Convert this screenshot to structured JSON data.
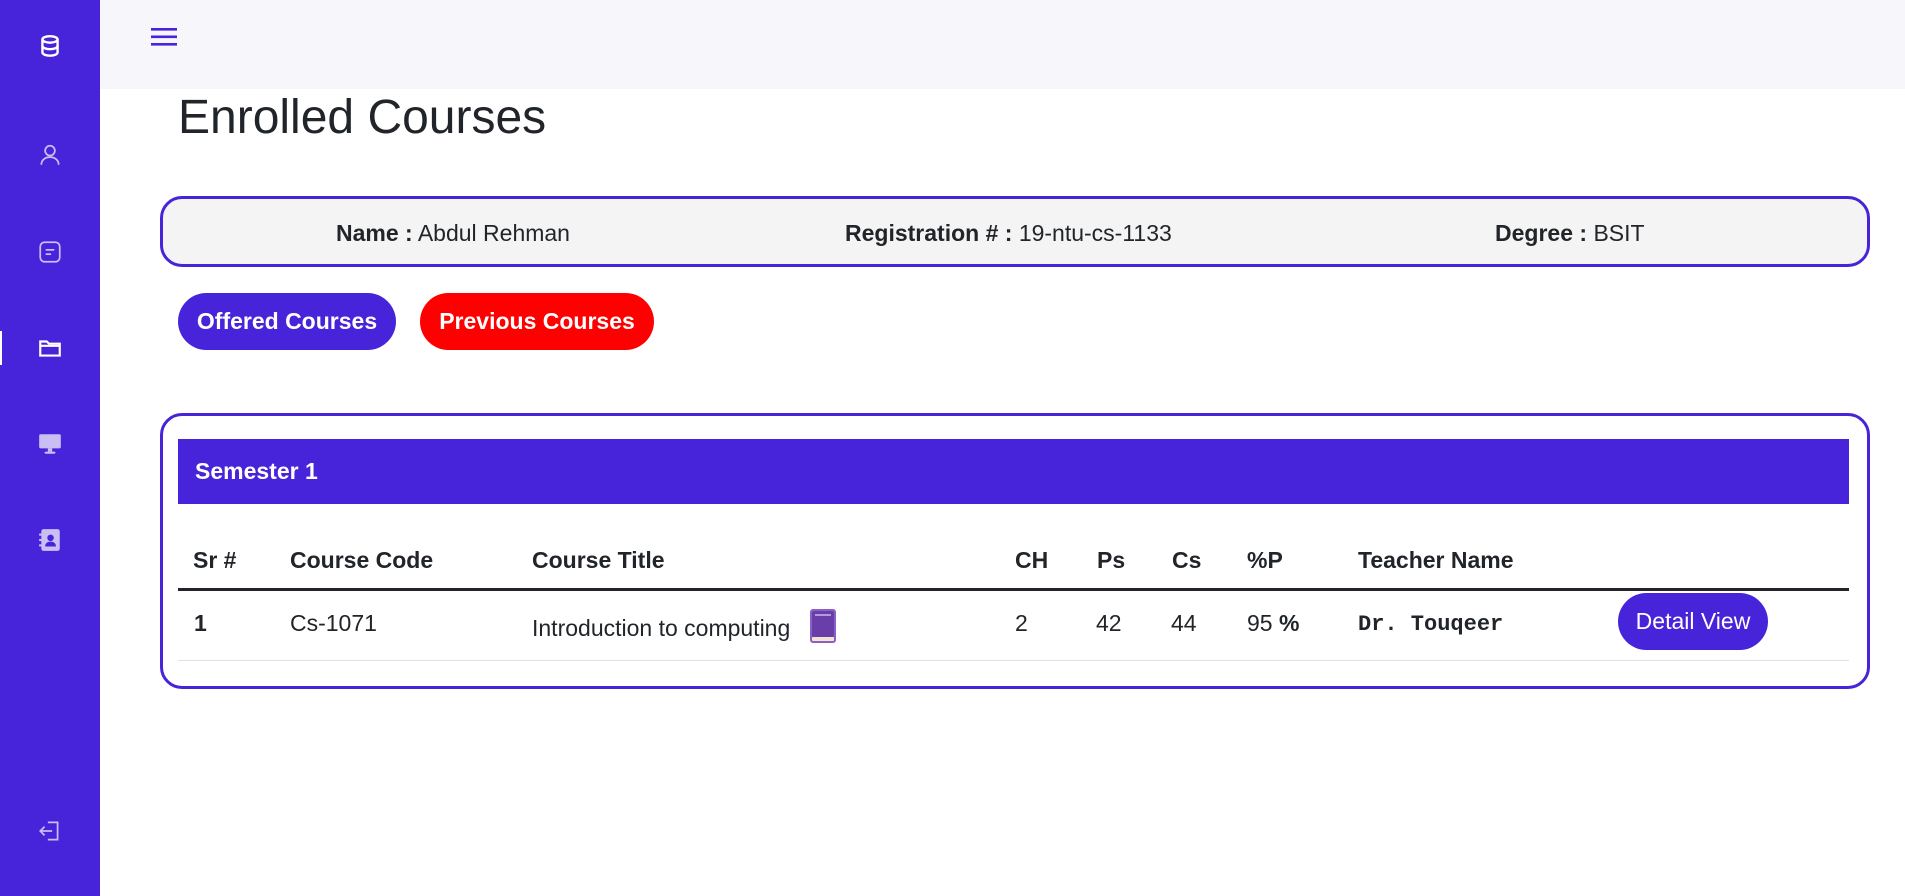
{
  "sidebar": {
    "items": [
      {
        "icon": "database-icon"
      },
      {
        "icon": "user-icon"
      },
      {
        "icon": "message-icon"
      },
      {
        "icon": "folder-icon",
        "active": true
      },
      {
        "icon": "monitor-icon"
      },
      {
        "icon": "contact-card-icon"
      },
      {
        "icon": "logout-icon"
      }
    ],
    "color": "#4723d9"
  },
  "header": {
    "menu_icon": "hamburger-icon"
  },
  "page": {
    "title": "Enrolled Courses"
  },
  "student": {
    "name_label": "Name :",
    "name_value": "Abdul Rehman",
    "reg_label": "Registration # :",
    "reg_value": "19-ntu-cs-1133",
    "degree_label": "Degree :",
    "degree_value": "BSIT"
  },
  "actions": {
    "offered_label": "Offered Courses",
    "previous_label": "Previous Courses"
  },
  "semester": {
    "title": "Semester 1",
    "columns": [
      "Sr #",
      "Course Code",
      "Course Title",
      "CH",
      "Ps",
      "Cs",
      "%P",
      "Teacher Name"
    ],
    "rows": [
      {
        "sr": "1",
        "code": "Cs-1071",
        "title": "Introduction to computing",
        "title_icon": "book-icon",
        "ch": "2",
        "ps": "42",
        "cs": "44",
        "percent_value": "95",
        "percent_sign": "%",
        "teacher": "Dr. Touqeer",
        "action_label": "Detail View"
      }
    ]
  },
  "colors": {
    "accent": "#4723d9",
    "danger": "#ff0000",
    "topbar": "#f7f6fb"
  }
}
